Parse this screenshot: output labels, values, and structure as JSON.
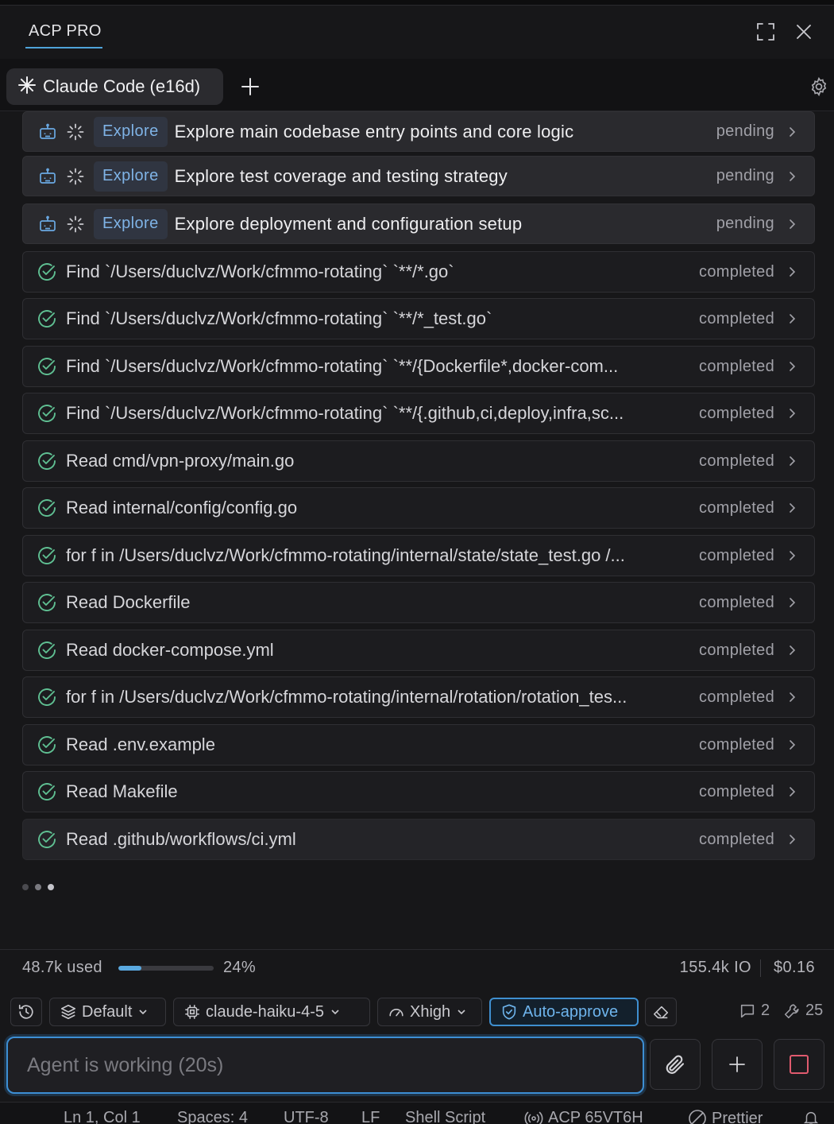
{
  "header": {
    "title": "ACP PRO"
  },
  "tabs": [
    {
      "label": "Claude Code (e16d)"
    }
  ],
  "tasks": [
    {
      "kind": "explore",
      "badge": "Explore",
      "label": "Explore main codebase entry points and core logic",
      "status": "pending"
    },
    {
      "kind": "explore",
      "badge": "Explore",
      "label": "Explore test coverage and testing strategy",
      "status": "pending"
    },
    {
      "kind": "explore",
      "badge": "Explore",
      "label": "Explore deployment and configuration setup",
      "status": "pending"
    },
    {
      "kind": "tool",
      "label": "Find `/Users/duclvz/Work/cfmmo-rotating` `**/*.go`",
      "status": "completed"
    },
    {
      "kind": "tool",
      "label": "Find `/Users/duclvz/Work/cfmmo-rotating` `**/*_test.go`",
      "status": "completed"
    },
    {
      "kind": "tool",
      "label": "Find `/Users/duclvz/Work/cfmmo-rotating` `**/{Dockerfile*,docker-com...",
      "status": "completed"
    },
    {
      "kind": "tool",
      "label": "Find `/Users/duclvz/Work/cfmmo-rotating` `**/{.github,ci,deploy,infra,sc...",
      "status": "completed"
    },
    {
      "kind": "tool",
      "label": "Read cmd/vpn-proxy/main.go",
      "status": "completed"
    },
    {
      "kind": "tool",
      "label": "Read internal/config/config.go",
      "status": "completed"
    },
    {
      "kind": "tool",
      "label": "for f in /Users/duclvz/Work/cfmmo-rotating/internal/state/state_test.go /...",
      "status": "completed"
    },
    {
      "kind": "tool",
      "label": "Read Dockerfile",
      "status": "completed"
    },
    {
      "kind": "tool",
      "label": "Read docker-compose.yml",
      "status": "completed"
    },
    {
      "kind": "tool",
      "label": "for f in /Users/duclvz/Work/cfmmo-rotating/internal/rotation/rotation_tes...",
      "status": "completed"
    },
    {
      "kind": "tool",
      "label": "Read .env.example",
      "status": "completed"
    },
    {
      "kind": "tool",
      "label": "Read Makefile",
      "status": "completed"
    },
    {
      "kind": "tool",
      "label": "Read .github/workflows/ci.yml",
      "status": "completed"
    }
  ],
  "usage": {
    "used": "48.7k used",
    "percent": "24%",
    "percent_value": 24,
    "io": "155.4k IO",
    "cost": "$0.16"
  },
  "toolbar": {
    "mode": "Default",
    "model": "claude-haiku-4-5",
    "effort": "Xhigh",
    "approve": "Auto-approve",
    "messages_count": "2",
    "tools_count": "25"
  },
  "input": {
    "placeholder": "Agent is working (20s)"
  },
  "statusbar": {
    "position": "Ln 1, Col 1",
    "spaces": "Spaces: 4",
    "encoding": "UTF-8",
    "eol": "LF",
    "language": "Shell Script",
    "acp": "ACP 65VT6H",
    "formatter": "Prettier"
  }
}
